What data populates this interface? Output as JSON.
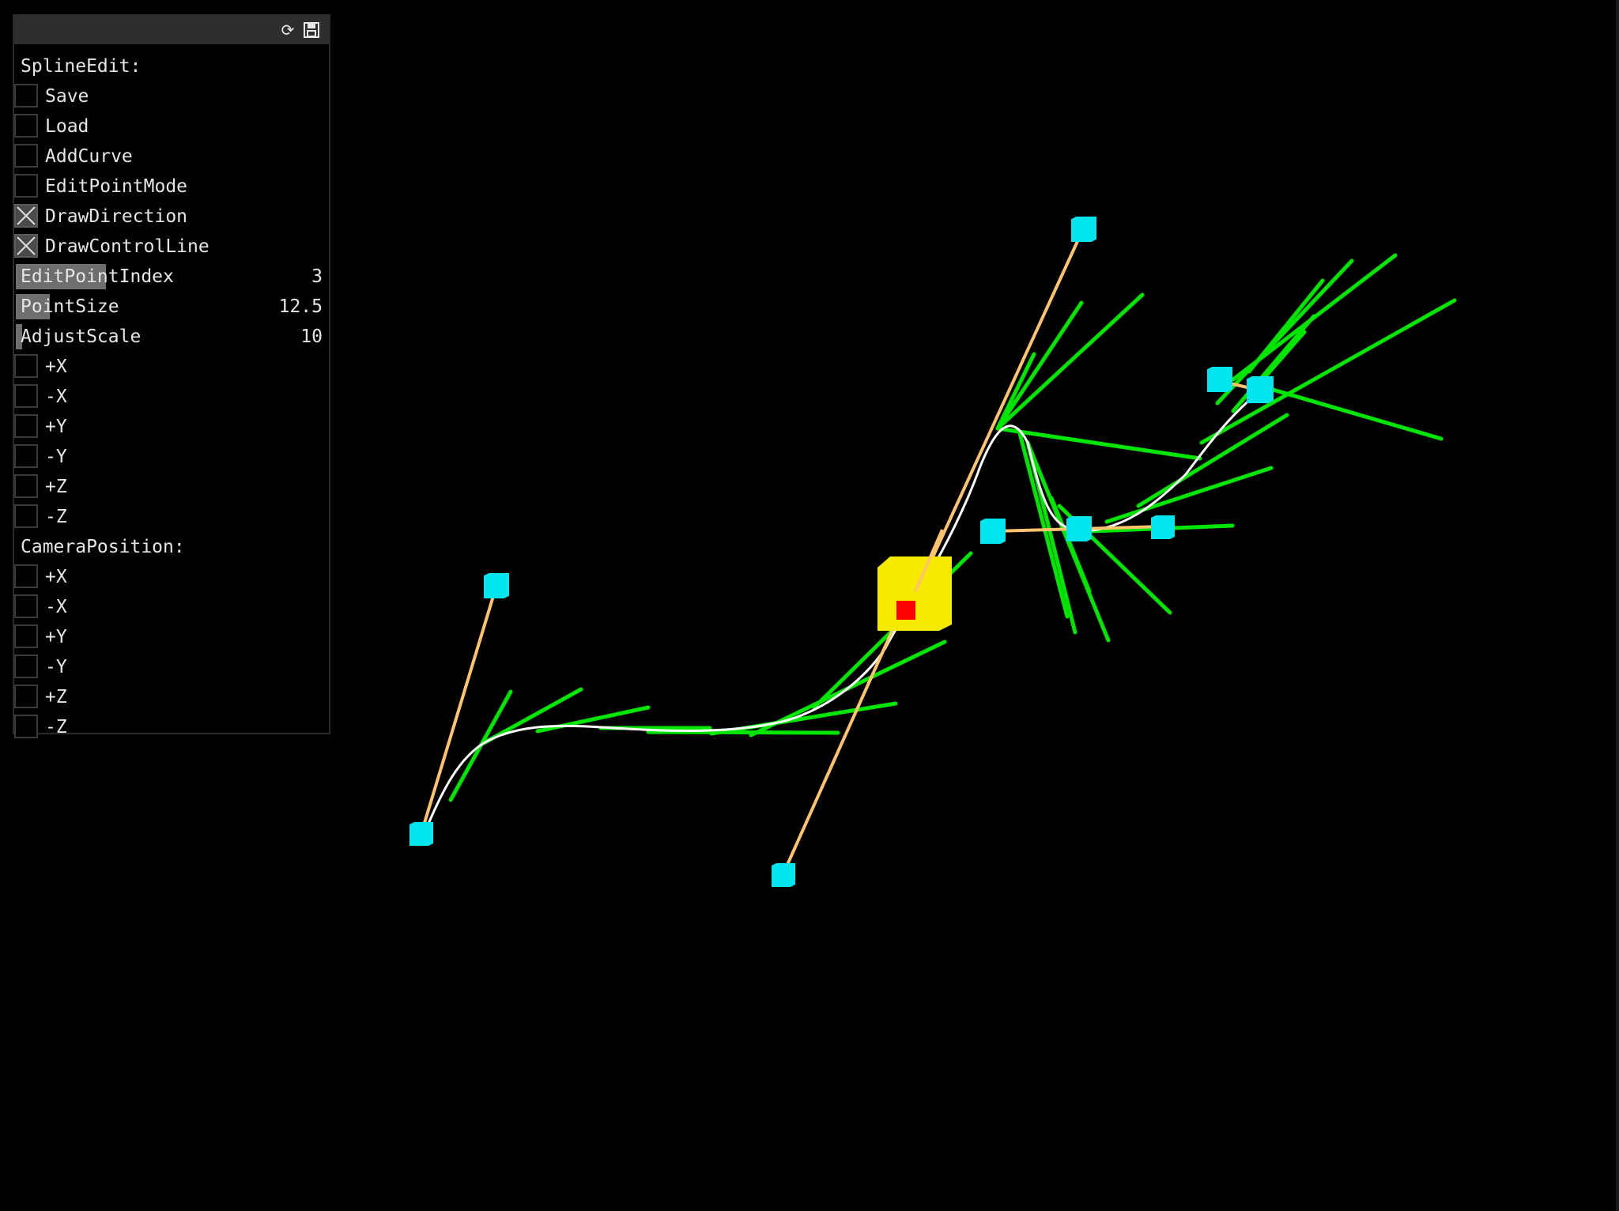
{
  "panel": {
    "icons": {
      "refresh": "refresh-icon",
      "save": "save-icon"
    },
    "spline_section_label": "SplineEdit:",
    "checkboxes": [
      {
        "label": "Save",
        "checked": false
      },
      {
        "label": "Load",
        "checked": false
      },
      {
        "label": "AddCurve",
        "checked": false
      },
      {
        "label": "EditPointMode",
        "checked": false
      },
      {
        "label": "DrawDirection",
        "checked": true
      },
      {
        "label": "DrawControlLine",
        "checked": true
      }
    ],
    "sliders": [
      {
        "label": "EditPointIndex",
        "value": "3",
        "level": 0.29
      },
      {
        "label": "PointSize",
        "value": "12.5",
        "level": 0.11
      },
      {
        "label": "AdjustScale",
        "value": "10",
        "level": 0.02
      }
    ],
    "adjust_buttons": [
      "+X",
      "-X",
      "+Y",
      "-Y",
      "+Z",
      "-Z"
    ],
    "camera_section_label": "CameraPosition:",
    "camera_buttons": [
      "+X",
      "-X",
      "+Y",
      "-Y",
      "+Z",
      "-Z"
    ]
  },
  "colors": {
    "background": "#000000",
    "curve": "#ffffff",
    "direction_lines": "#00e600",
    "control_lines": "#ffc46b",
    "control_points": "#00e5ee",
    "selected_point": "#f5ea00",
    "selected_marker": "#ff0000"
  }
}
